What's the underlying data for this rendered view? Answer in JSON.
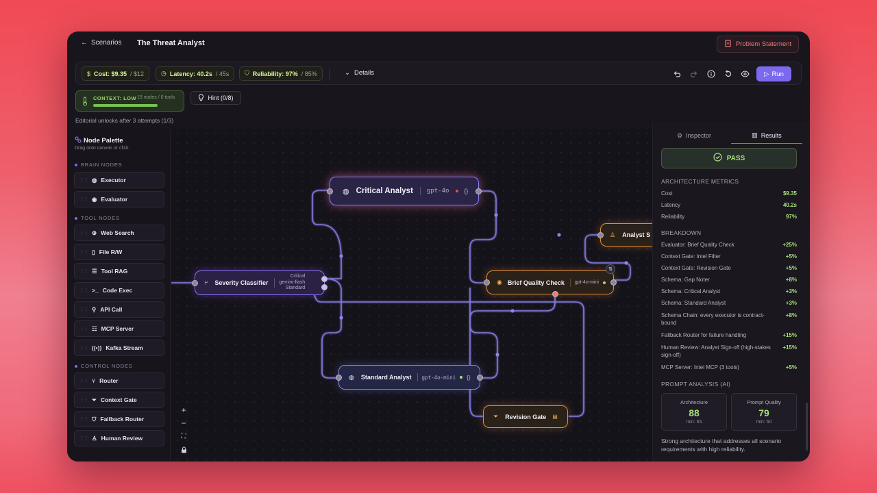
{
  "header": {
    "back_label": "Scenarios",
    "title": "The Threat Analyst",
    "problem_label": "Problem Statement"
  },
  "metrics": {
    "cost": {
      "label": "Cost: $9.35",
      "limit": "/ $12"
    },
    "latency": {
      "label": "Latency: 40.2s",
      "limit": "/ 45s"
    },
    "reliability": {
      "label": "Reliability: 97%",
      "limit": "/ 85%"
    },
    "details_label": "Details",
    "run_label": "Run"
  },
  "context": {
    "label": "CONTEXT: LOW",
    "sub": "15 nodes / 0 tools",
    "fill": 0.82
  },
  "hint_label": "Hint (0/8)",
  "editorial": "Editorial unlocks after 3 attempts (1/3)",
  "palette": {
    "title": "Node Palette",
    "subtitle": "Drag onto canvas or click",
    "brain_heading": "BRAIN NODES",
    "brain": [
      "Executor",
      "Evaluator"
    ],
    "tool_heading": "TOOL NODES",
    "tools": [
      "Web Search",
      "File R/W",
      "Tool RAG",
      "Code Exec",
      "API Call",
      "MCP Server",
      "Kafka Stream"
    ],
    "control_heading": "CONTROL NODES",
    "control": [
      "Router",
      "Context Gate",
      "Fallback Router",
      "Human Review"
    ]
  },
  "nodes": {
    "critical": {
      "title": "Critical Analyst",
      "model": "gpt-4o",
      "tag": "{}"
    },
    "severity": {
      "title": "Severity Classifier",
      "l1": "Critical",
      "l2": "gemini-flash",
      "l3": "Standard"
    },
    "brief": {
      "title": "Brief Quality Check",
      "model": "gpt-4o-mini"
    },
    "standard": {
      "title": "Standard Analyst",
      "model": "gpt-4o-mini",
      "tag": "{}"
    },
    "revision": {
      "title": "Revision Gate"
    },
    "analyst": {
      "title": "Analyst S"
    }
  },
  "inspector": {
    "tab_inspector": "Inspector",
    "tab_results": "Results",
    "pass": "PASS",
    "arch_heading": "ARCHITECTURE METRICS",
    "arch": [
      {
        "k": "Cost",
        "v": "$9.35"
      },
      {
        "k": "Latency",
        "v": "40.2s"
      },
      {
        "k": "Reliability",
        "v": "97%"
      }
    ],
    "breakdown_heading": "BREAKDOWN",
    "breakdown": [
      {
        "k": "Evaluator: Brief Quality Check",
        "v": "+25%"
      },
      {
        "k": "Context Gate: Intel Filter",
        "v": "+5%"
      },
      {
        "k": "Context Gate: Revision Gate",
        "v": "+5%"
      },
      {
        "k": "Schema: Gap Noter",
        "v": "+8%"
      },
      {
        "k": "Schema: Critical Analyst",
        "v": "+3%"
      },
      {
        "k": "Schema: Standard Analyst",
        "v": "+3%"
      },
      {
        "k": "Schema Chain: every executor is contract-bound",
        "v": "+8%"
      },
      {
        "k": "Fallback Router for failure handling",
        "v": "+15%"
      },
      {
        "k": "Human Review: Analyst Sign-off (high-stakes sign-off)",
        "v": "+15%"
      },
      {
        "k": "MCP Server: Intel MCP (3 tools)",
        "v": "+5%"
      }
    ],
    "prompt_heading": "PROMPT ANALYSIS (AI)",
    "arch_score": {
      "t": "Architecture",
      "n": "88",
      "m": "min: 65"
    },
    "prompt_score": {
      "t": "Prompt Quality",
      "n": "79",
      "m": "min: 60"
    },
    "summary": "Strong architecture that addresses all scenario requirements with high reliability."
  },
  "colors": {
    "accent": "#7b6af0",
    "pass": "#a8e07a",
    "warn": "#f07a7a"
  }
}
